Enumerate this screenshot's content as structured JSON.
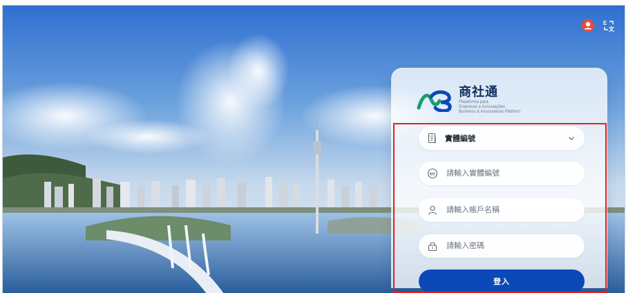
{
  "header": {
    "user_icon": "user-circle-icon",
    "language_icon": "language-switch-icon"
  },
  "brand": {
    "name": "商社通",
    "subtitle_line1": "Plataforma para",
    "subtitle_line2": "Empresas e Associações",
    "subtitle_line3": "Business & Associations Platform"
  },
  "login_form": {
    "entity_select": {
      "selected": "實體編號",
      "icon": "document-icon"
    },
    "entity_number": {
      "placeholder": "請輸入實體編號",
      "icon": "no-badge-icon"
    },
    "username": {
      "placeholder": "請輸入帳戶名稱",
      "icon": "user-icon"
    },
    "password": {
      "placeholder": "請輸入密碼",
      "icon": "lock-icon"
    },
    "submit_label": "登入"
  },
  "colors": {
    "primary": "#0B49B8",
    "highlight_border": "#E02020",
    "user_icon": "#E84A3C"
  }
}
